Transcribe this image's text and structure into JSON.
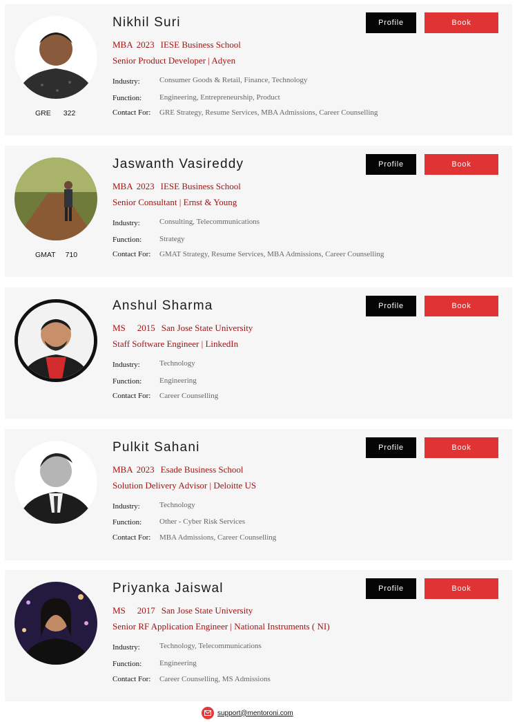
{
  "labels": {
    "industry": "Industry:",
    "function": "Function:",
    "contact": "Contact For:",
    "profile_button": "Profile",
    "book_button": "Book"
  },
  "mentors": [
    {
      "name": "Nikhil Suri",
      "degree": "MBA",
      "year": "2023",
      "school": "IESE Business School",
      "job": "Senior Product Developer | Adyen",
      "industry": "Consumer Goods & Retail, Finance, Technology",
      "function": "Engineering, Entrepreneurship, Product",
      "contact_for": "GRE Strategy, Resume Services, MBA Admissions, Career Counselling",
      "test_name": "GRE",
      "test_score": "322"
    },
    {
      "name": "Jaswanth Vasireddy",
      "degree": "MBA",
      "year": "2023",
      "school": "IESE Business School",
      "job": "Senior Consultant | Ernst & Young",
      "industry": "Consulting, Telecommunications",
      "function": "Strategy",
      "contact_for": "GMAT Strategy, Resume Services, MBA Admissions, Career Counselling",
      "test_name": "GMAT",
      "test_score": "710"
    },
    {
      "name": "Anshul Sharma",
      "degree": "MS",
      "year": "2015",
      "school": "San Jose State University",
      "job": "Staff Software Engineer | LinkedIn",
      "industry": "Technology",
      "function": "Engineering",
      "contact_for": "Career Counselling"
    },
    {
      "name": "Pulkit Sahani",
      "degree": "MBA",
      "year": "2023",
      "school": "Esade Business School",
      "job": "Solution Delivery Advisor | Deloitte US",
      "industry": "Technology",
      "function": "Other - Cyber Risk Services",
      "contact_for": "MBA Admissions, Career Counselling"
    },
    {
      "name": "Priyanka Jaiswal",
      "degree": "MS",
      "year": "2017",
      "school": "San Jose State University",
      "job": "Senior RF Application Engineer | National Instruments ( NI)",
      "industry": "Technology, Telecommunications",
      "function": "Engineering",
      "contact_for": "Career Counselling, MS Admissions"
    }
  ],
  "footer": {
    "email": "support@mentoroni.com",
    "icon": "mail-icon"
  },
  "colors": {
    "accent_red": "#e03333",
    "text_red": "#a01414",
    "card_bg": "#f6f6f6"
  }
}
